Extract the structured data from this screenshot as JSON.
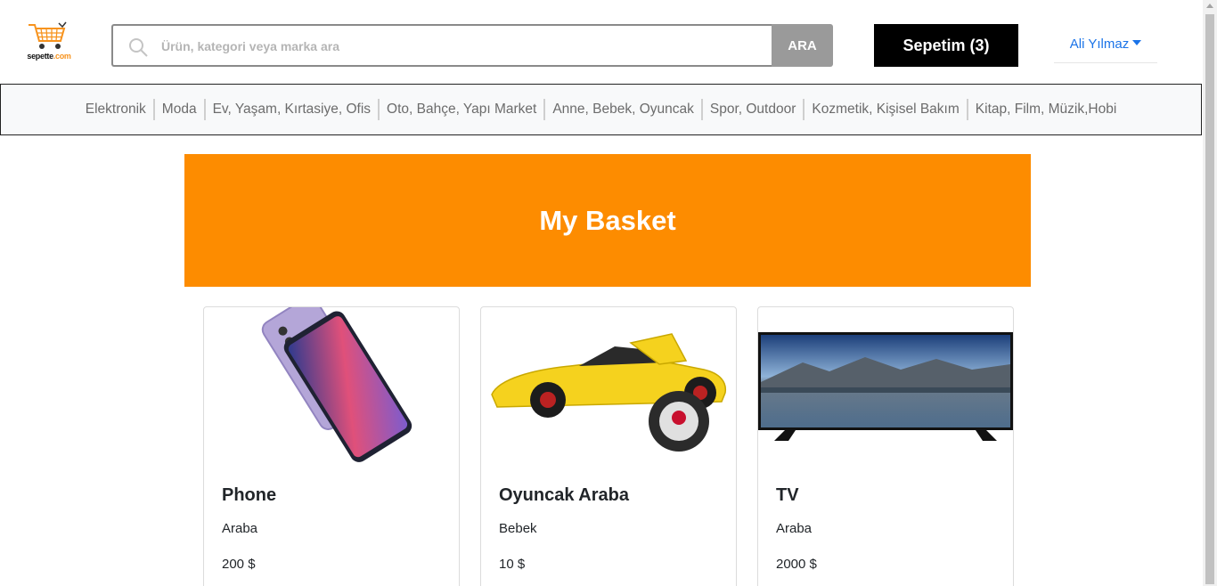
{
  "logo": {
    "text_main": "sepette",
    "text_suffix": ".com",
    "icon": "shopping-cart-icon"
  },
  "search": {
    "placeholder": "Ürün, kategori veya marka ara",
    "value": "",
    "button_label": "ARA",
    "icon": "search-icon"
  },
  "cart": {
    "label": "Sepetim (3)"
  },
  "user": {
    "name": "Ali Yılmaz",
    "icon": "caret-down-icon"
  },
  "categories": [
    "Elektronik",
    "Moda",
    "Ev, Yaşam, Kırtasiye, Ofis",
    "Oto, Bahçe, Yapı Market",
    "Anne, Bebek, Oyuncak",
    "Spor, Outdoor",
    "Kozmetik, Kişisel Bakım",
    "Kitap, Film, Müzik,Hobi"
  ],
  "banner": {
    "title": "My Basket",
    "color": "#fd8c00"
  },
  "products": [
    {
      "name": "Phone",
      "category": "Araba",
      "price": "200 $",
      "image": "phone-image"
    },
    {
      "name": "Oyuncak Araba",
      "category": "Bebek",
      "price": "10 $",
      "image": "toy-car-image"
    },
    {
      "name": "TV",
      "category": "Araba",
      "price": "2000 $",
      "image": "tv-image"
    }
  ],
  "colors": {
    "accent": "#fd8c00",
    "link": "#1a73e8",
    "cart_bg": "#000000",
    "search_button": "#9a9a9a"
  }
}
